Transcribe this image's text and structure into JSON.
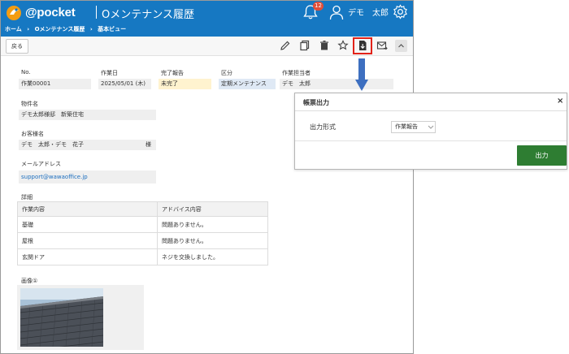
{
  "header": {
    "logo_text": "@pocket",
    "app_title": "Oメンテナンス履歴",
    "notification_count": "12",
    "user_name": "デモ　太郎"
  },
  "breadcrumb": [
    "ホーム",
    "›",
    "Oメンテナンス履歴",
    "›",
    "基本ビュー"
  ],
  "toolbar": {
    "back_label": "戻る",
    "icons": [
      "pencil-icon",
      "copy-icon",
      "trash-icon",
      "star-icon",
      "document-export-icon",
      "mail-icon",
      "chevron-up-icon"
    ]
  },
  "record": {
    "no_label": "No.",
    "no_value": "作業00001",
    "date_label": "作業日",
    "date_value": "2025/05/01 (木)",
    "status_label": "完了報告",
    "status_value": "未完了",
    "category_label": "区分",
    "category_value": "定期メンテナンス",
    "assignee_label": "作業担当者",
    "assignee_value": "デモ　太郎",
    "property_label": "物件名",
    "property_value": "デモ太郎様邸　新築住宅",
    "customer_label": "お客様名",
    "customer_value": "デモ　太郎・デモ　花子",
    "customer_suffix": "様",
    "email_label": "メールアドレス",
    "email_value": "support@wawaoffice.jp"
  },
  "details": {
    "section_label": "詳細",
    "headers": [
      "作業内容",
      "アドバイス内容"
    ],
    "rows": [
      [
        "基礎",
        "問題ありません。"
      ],
      [
        "屋根",
        "問題ありません。"
      ],
      [
        "玄関ドア",
        "ネジを交換しました。"
      ]
    ]
  },
  "image_section": {
    "label": "画像①"
  },
  "dialog": {
    "title": "帳票出力",
    "close_symbol": "×",
    "format_label": "出力形式",
    "format_selected": "作業報告",
    "output_button": "出力"
  },
  "colors": {
    "brand": "#1678c2",
    "highlight": "#e2231a",
    "output_button": "#2e7d32",
    "arrow": "#3d6fc0"
  }
}
